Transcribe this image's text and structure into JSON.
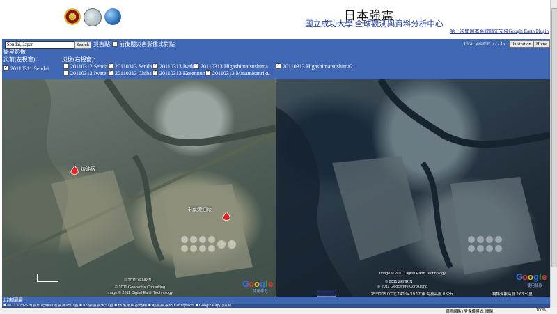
{
  "header": {
    "title": "日本強震",
    "subtitle": "國立成功大學 全球觀測與資料分析中心",
    "top_link": "第一次使用本系統請先安裝Google Earth Plugin"
  },
  "toolbar": {
    "search_value": "Sendai, Japan",
    "search_button": "Search",
    "disaster_label": "災害點:",
    "compare_label": "前後期災害影像比對點",
    "visitor_label": "Total Visitor: 77735",
    "illustration_button": "Illustration",
    "home_button": "Home"
  },
  "imagery": {
    "section_label": "衛星影像",
    "before_label": "災前(左視窗):",
    "after_label": "災後(右視窗):",
    "before_items": [
      {
        "label": "20110311 Sendai",
        "checked": true
      }
    ],
    "after_row1": [
      {
        "label": "20110312 Sendai",
        "checked": false
      },
      {
        "label": "20110313 Sendai",
        "checked": true
      },
      {
        "label": "20110313 Iwaki",
        "checked": true
      },
      {
        "label": "20110313 Higashimatsushima",
        "checked": true
      },
      {
        "label": "20110313 Higashimatsushima2",
        "checked": true
      }
    ],
    "after_row2": [
      {
        "label": "20110312 Iwate",
        "checked": false
      },
      {
        "label": "20110313 Chiba",
        "checked": true
      },
      {
        "label": "20110313 Kesennuma",
        "checked": true
      },
      {
        "label": "20110313 Minamisanriku",
        "checked": true
      }
    ]
  },
  "left_map": {
    "fire_label_1": "煉油廠",
    "fire_label_2": "千葉煉油廠",
    "credit1": "© 2011 ZENRIN",
    "credit2": "© 2011 Geocentre Consulting",
    "credit3": "Image © 2011 Digital Earth Technology",
    "logo": "Google",
    "terms": "使用條款"
  },
  "right_map": {
    "credit0": "Image © 2011 Digital Earth Technology",
    "credit1": "© 2011 ZENRIN",
    "credit2": "© 2011 Geocentre Consulting",
    "coords": "35°30'15.00\"北 140°04'19.17\"東 海拔高度 0 公尺",
    "altitude": "視角海拔高度  2.63 公里",
    "year": "2004",
    "logo": "Google",
    "terms": "使用條款"
  },
  "bottom": {
    "legend": "災害圖層",
    "layers": "■ NOAA 日本海震所記錄各地震測站位置  ■ 8.9強震震央位置  ■ 核電廠與發電廠  ■ 地震震源點 Earthquakes  ■ GoogleMap災情點"
  },
  "statusbar": {
    "zone": "網際網路 | 受保護模式: 關閉",
    "zoom": "100%"
  }
}
